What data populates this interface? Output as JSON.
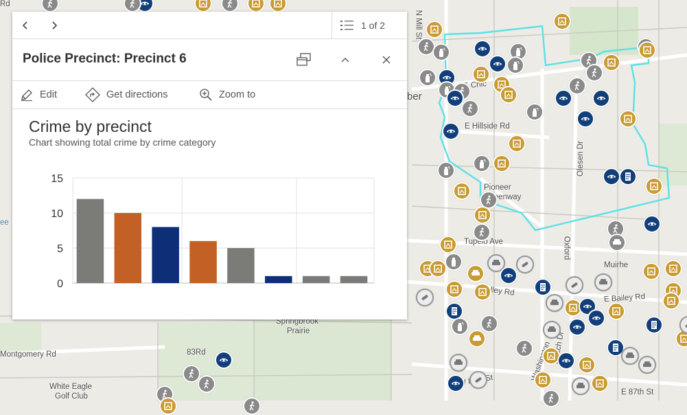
{
  "map": {
    "labels": [
      {
        "text": "E Chic",
        "pos": "chicago-ave"
      },
      {
        "text": "E Hillside Rd",
        "pos": "hillside"
      },
      {
        "text": "Olesen Dr",
        "pos": "olesen"
      },
      {
        "text": "Pioneer",
        "pos": "pioneer"
      },
      {
        "text": "Greenway",
        "pos": "greenway"
      },
      {
        "text": "Tupelo Ave",
        "pos": "tupelo"
      },
      {
        "text": "Oxford",
        "pos": "oxford"
      },
      {
        "text": "Muirhe",
        "pos": "muirhead"
      },
      {
        "text": "E Bailey Rd",
        "pos": "bailey"
      },
      {
        "text": "alley Rd",
        "pos": "alley"
      },
      {
        "text": "Springbrook",
        "pos": "springbrook"
      },
      {
        "text": "Prairie",
        "pos": "prairie"
      },
      {
        "text": "Montgomery Rd",
        "pos": "montgomery"
      },
      {
        "text": "83Rd",
        "pos": "83rd"
      },
      {
        "text": "White Eagle",
        "pos": "whiteeagle"
      },
      {
        "text": "Golf Club",
        "pos": "golfclub"
      },
      {
        "text": "W 87th St",
        "pos": "w87"
      },
      {
        "text": "E 87th St",
        "pos": "e87"
      },
      {
        "text": "Washington",
        "pos": "washington"
      },
      {
        "text": "Beach Dr",
        "pos": "beach"
      },
      {
        "text": "N Mill St",
        "pos": "nmill"
      },
      {
        "text": "ber",
        "pos": "ber"
      },
      {
        "text": "Rd",
        "pos": "rd-top"
      },
      {
        "text": "ee",
        "pos": "ee"
      }
    ],
    "precinct_outline_color": "#5ce1e6"
  },
  "popup": {
    "pager": "1 of 2",
    "title": "Police Precinct: Precinct 6",
    "actions": {
      "edit": "Edit",
      "directions": "Get directions",
      "zoom": "Zoom to"
    },
    "chart_title": "Crime by precinct",
    "chart_subtitle": "Chart showing total crime by crime category"
  },
  "chart_data": {
    "type": "bar",
    "title": "Crime by precinct",
    "subtitle": "Chart showing total crime by crime category",
    "xlabel": "",
    "ylabel": "",
    "ylim": [
      0,
      15
    ],
    "yticks": [
      0,
      5,
      10,
      15
    ],
    "grid": true,
    "values": [
      12,
      10,
      8,
      6,
      5,
      1,
      1,
      1
    ],
    "colors": [
      "#7b7b78",
      "#c26026",
      "#0c2f77",
      "#c26026",
      "#7b7b78",
      "#0c2f77",
      "#7b7b78",
      "#7b7b78"
    ]
  }
}
